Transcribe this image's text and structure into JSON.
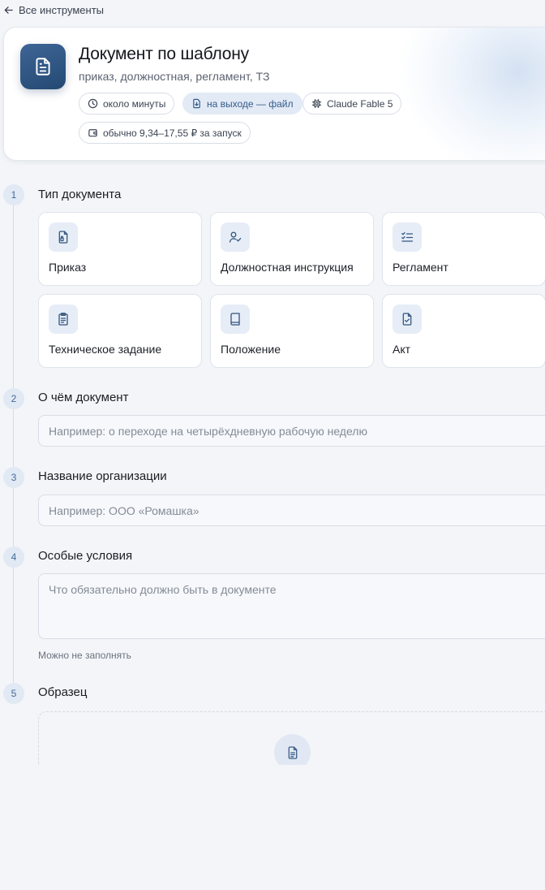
{
  "nav": {
    "back_label": "Все инструменты"
  },
  "tool": {
    "title": "Документ по шаблону",
    "subtitle": "приказ, должностная, регламент, ТЗ",
    "icon": "document-icon",
    "chips": [
      {
        "label": "около минуты",
        "icon": "clock-icon"
      },
      {
        "label": "на выходе — файл",
        "icon": "file-download-icon"
      },
      {
        "label": "Claude Fable 5",
        "icon": "chip-icon"
      },
      {
        "label": "обычно 9,34–17,55 ₽ за запуск",
        "icon": "wallet-icon"
      }
    ]
  },
  "steps": [
    {
      "number": "1",
      "title": "Тип документа"
    },
    {
      "number": "2",
      "title": "О чём документ"
    },
    {
      "number": "3",
      "title": "Название организации"
    },
    {
      "number": "4",
      "title": "Особые условия"
    },
    {
      "number": "5",
      "title": "Образец"
    }
  ],
  "doc_types": [
    {
      "label": "Приказ",
      "icon": "order-file-icon"
    },
    {
      "label": "Должностная инструкция",
      "icon": "user-check-icon"
    },
    {
      "label": "Регламент",
      "icon": "checklist-icon"
    },
    {
      "label": "Техническое задание",
      "icon": "clipboard-icon"
    },
    {
      "label": "Положение",
      "icon": "book-icon"
    },
    {
      "label": "Акт",
      "icon": "file-check-icon"
    }
  ],
  "fields": {
    "topic_placeholder": "Например: о переходе на четырёхдневную рабочую неделю",
    "org_placeholder": "Например: ООО «Ромашка»",
    "conditions_placeholder": "Что обязательно должно быть в документе",
    "conditions_hint": "Можно не заполнять"
  },
  "sample": {
    "icon": "document-icon"
  },
  "colors": {
    "accent": "#2f5583",
    "accent_soft": "#e2eaf5",
    "background": "#f3f5f8"
  }
}
